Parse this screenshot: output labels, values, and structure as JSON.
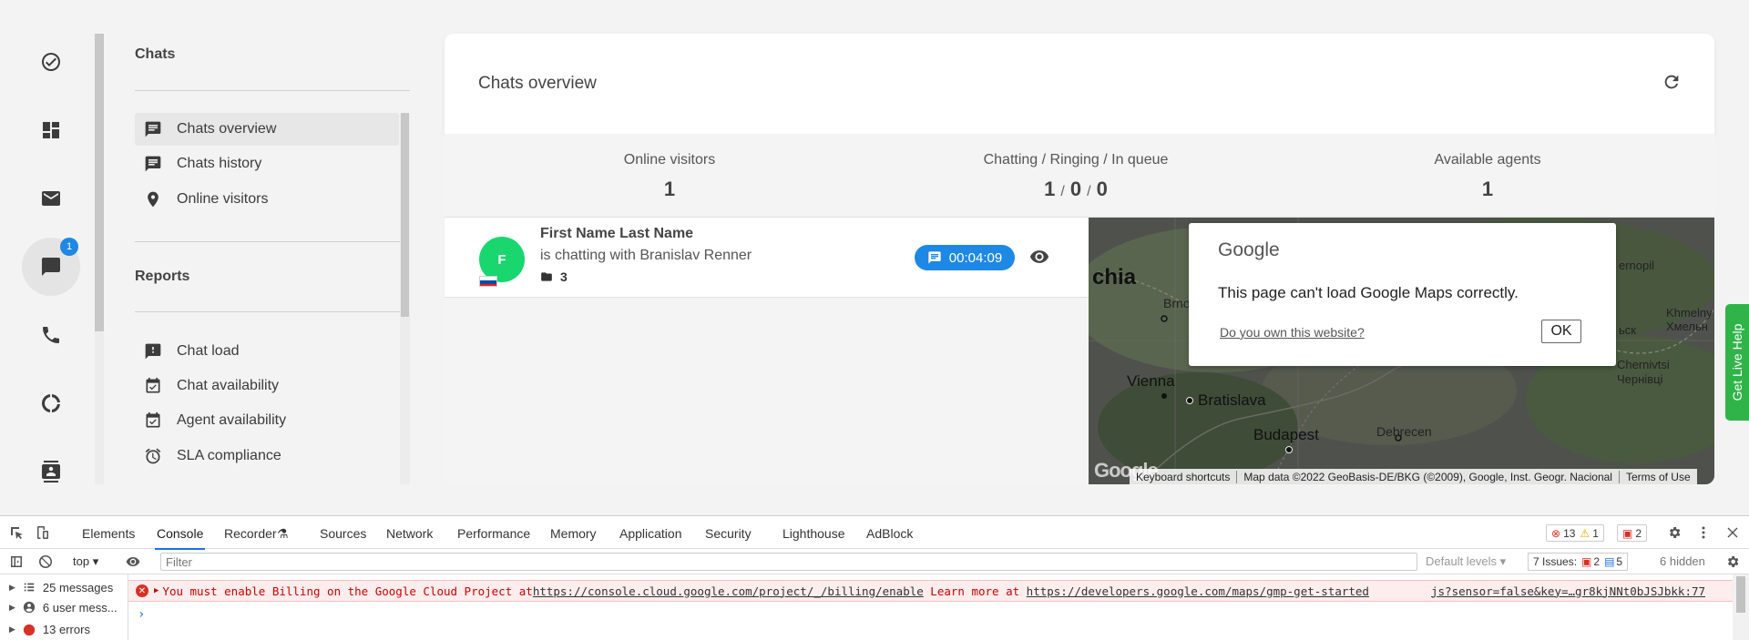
{
  "rail": {
    "chat_badge": "1"
  },
  "sidebar": {
    "chats_title": "Chats",
    "chats_items": [
      {
        "label": "Chats overview",
        "icon": "chat-bubble-icon"
      },
      {
        "label": "Chats history",
        "icon": "chat-bubble-icon"
      },
      {
        "label": "Online visitors",
        "icon": "location-pin-icon"
      }
    ],
    "reports_title": "Reports",
    "reports_items": [
      {
        "label": "Chat load",
        "icon": "alert-chat-icon"
      },
      {
        "label": "Chat availability",
        "icon": "calendar-check-icon"
      },
      {
        "label": "Agent availability",
        "icon": "calendar-check-icon"
      },
      {
        "label": "SLA compliance",
        "icon": "alarm-icon"
      }
    ]
  },
  "main": {
    "title": "Chats overview",
    "stats": {
      "online_visitors_label": "Online visitors",
      "online_visitors_value": "1",
      "chatting_label": "Chatting / Ringing / In queue",
      "chatting_value": "1",
      "ringing_value": "0",
      "queue_value": "0",
      "sep": "/",
      "agents_label": "Available agents",
      "agents_value": "1"
    },
    "chat": {
      "avatar_letter": "F",
      "name": "First Name Last Name",
      "status": "is chatting with Branislav Renner",
      "folder_count": "3",
      "timer": "00:04:09"
    }
  },
  "map": {
    "labels": {
      "region": "chia",
      "brno": "Brno",
      "vienna": "Vienna",
      "bratislava": "Bratislava",
      "budapest": "Budapest",
      "debrecen": "Debrecen",
      "ternopil": "ernopil",
      "khmelny": "Khmelny",
      "khmelny_uk": "Хмельн",
      "lsk": "ьск",
      "chernivtsi": "Chernivtsi",
      "chernivtsi_uk": "Чернівці"
    },
    "dialog": {
      "brand": "Google",
      "message": "This page can't load Google Maps correctly.",
      "link": "Do you own this website?",
      "ok": "OK"
    },
    "footer": {
      "shortcuts": "Keyboard shortcuts",
      "attribution": "Map data ©2022 GeoBasis-DE/BKG (©2009), Google, Inst. Geogr. Nacional",
      "terms": "Terms of Use"
    },
    "logo": "Google"
  },
  "live_help": "Get Live Help",
  "devtools": {
    "tabs": [
      "Elements",
      "Console",
      "Recorder",
      "Sources",
      "Network",
      "Performance",
      "Memory",
      "Application",
      "Security",
      "Lighthouse",
      "AdBlock"
    ],
    "errors": "13",
    "warnings": "1",
    "issues_badge": "2",
    "context": "top",
    "filter_placeholder": "Filter",
    "levels": "Default levels",
    "issues_label": "7 Issues:",
    "issues_errors": "2",
    "issues_info": "5",
    "hidden": "6 hidden",
    "side": {
      "messages": "25 messages",
      "user_messages": "6 user mess...",
      "errors": "13 errors"
    },
    "error_line": {
      "prefix": "You must enable Billing on the Google Cloud Project at ",
      "link1": "https://console.cloud.google.com/project/_/billing/enable",
      "middle": " Learn more at ",
      "link2": "https://developers.google.com/maps/gmp-get-started",
      "source": "js?sensor=false&key=…gr8kjNNt0bJSJbkk:77"
    },
    "prompt": "›"
  }
}
